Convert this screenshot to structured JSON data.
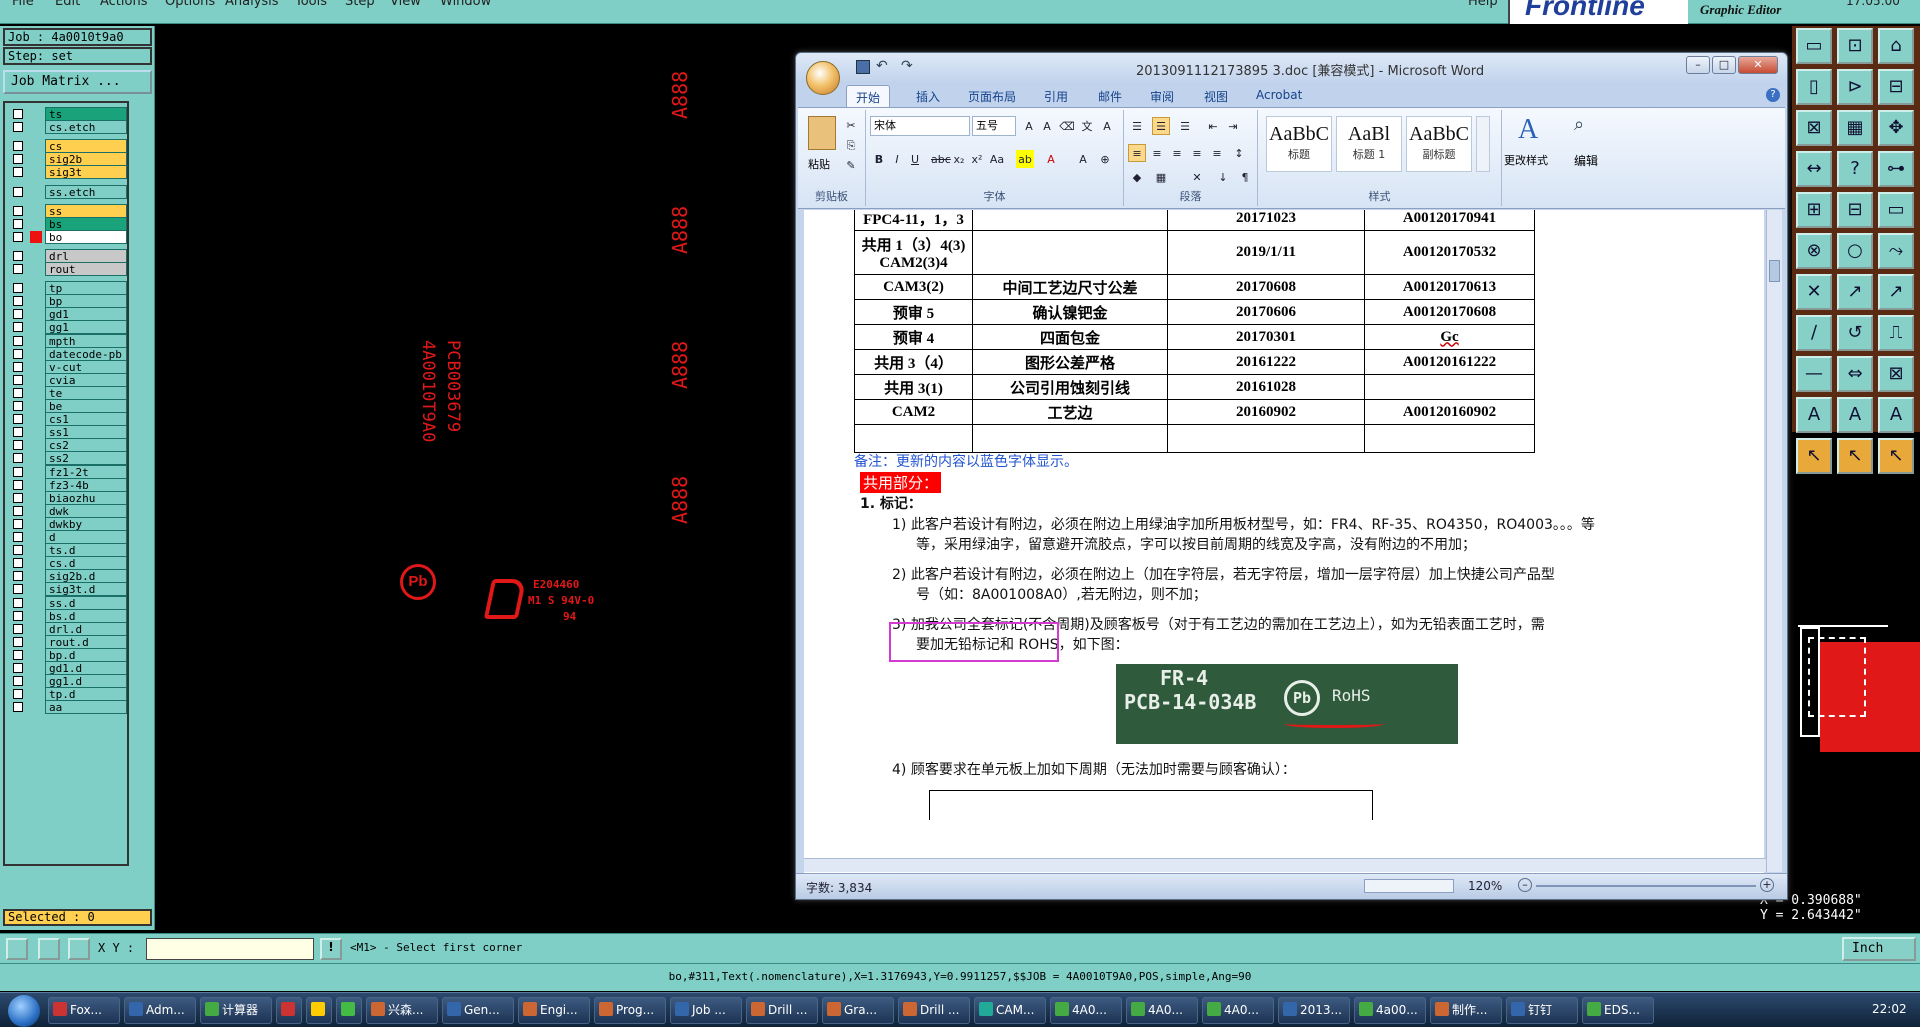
{
  "menubar": {
    "items": [
      "File",
      "Edit",
      "Actions",
      "Options",
      "Analysis",
      "Tools",
      "Step",
      "View",
      "Window"
    ],
    "help": "Help",
    "logo": "Frontline",
    "product": "Graphic Editor",
    "time": "17:05:00"
  },
  "job": {
    "job_label": "Job : 4a0010t9a0",
    "step_label": "Step: set",
    "matrix_button": "Job Matrix ...",
    "selected": "Selected : 0"
  },
  "layers": [
    {
      "name": "ts",
      "color": "#1aa37a"
    },
    {
      "name": "cs.etch",
      "color": "#7fcfc6"
    },
    {
      "name": "cs",
      "color": "#ffd050"
    },
    {
      "name": "sig2b",
      "color": "#ffd050"
    },
    {
      "name": "sig3t",
      "color": "#ffd050"
    },
    {
      "name": "ss.etch",
      "color": "#7fcfc6"
    },
    {
      "name": "ss",
      "color": "#ffd050"
    },
    {
      "name": "bs",
      "color": "#1aa37a"
    },
    {
      "name": "bo",
      "color": "#ffffff"
    },
    {
      "name": "drl",
      "color": "#c8c8c8"
    },
    {
      "name": "rout",
      "color": "#c8c8c8"
    },
    {
      "name": "tp",
      "color": "#7fcfc6"
    },
    {
      "name": "bp",
      "color": "#7fcfc6"
    },
    {
      "name": "gd1",
      "color": "#7fcfc6"
    },
    {
      "name": "gg1",
      "color": "#7fcfc6"
    },
    {
      "name": "mpth",
      "color": "#7fcfc6"
    },
    {
      "name": "datecode-pb",
      "color": "#7fcfc6"
    },
    {
      "name": "v-cut",
      "color": "#7fcfc6"
    },
    {
      "name": "cvia",
      "color": "#7fcfc6"
    },
    {
      "name": "te",
      "color": "#7fcfc6"
    },
    {
      "name": "be",
      "color": "#7fcfc6"
    },
    {
      "name": "cs1",
      "color": "#7fcfc6"
    },
    {
      "name": "ss1",
      "color": "#7fcfc6"
    },
    {
      "name": "cs2",
      "color": "#7fcfc6"
    },
    {
      "name": "ss2",
      "color": "#7fcfc6"
    },
    {
      "name": "fz1-2t",
      "color": "#7fcfc6"
    },
    {
      "name": "fz3-4b",
      "color": "#7fcfc6"
    },
    {
      "name": "biaozhu",
      "color": "#7fcfc6"
    },
    {
      "name": "dwk",
      "color": "#7fcfc6"
    },
    {
      "name": "dwkby",
      "color": "#7fcfc6"
    },
    {
      "name": "d",
      "color": "#7fcfc6"
    },
    {
      "name": "ts.d",
      "color": "#7fcfc6"
    },
    {
      "name": "cs.d",
      "color": "#7fcfc6"
    },
    {
      "name": "sig2b.d",
      "color": "#7fcfc6"
    },
    {
      "name": "sig3t.d",
      "color": "#7fcfc6"
    },
    {
      "name": "ss.d",
      "color": "#7fcfc6"
    },
    {
      "name": "bs.d",
      "color": "#7fcfc6"
    },
    {
      "name": "drl.d",
      "color": "#7fcfc6"
    },
    {
      "name": "rout.d",
      "color": "#7fcfc6"
    },
    {
      "name": "bp.d",
      "color": "#7fcfc6"
    },
    {
      "name": "gd1.d",
      "color": "#7fcfc6"
    },
    {
      "name": "gg1.d",
      "color": "#7fcfc6"
    },
    {
      "name": "tp.d",
      "color": "#7fcfc6"
    },
    {
      "name": "aa",
      "color": "#7fcfc6"
    }
  ],
  "canvas": {
    "a888": "A888",
    "pcb_text": "PCB003679",
    "job_text": "4A0010T9A0",
    "pb_mark": "Pb",
    "ul_code": "E204460",
    "ul_sub": "M1 S 94V-0",
    "ul_mark": "94"
  },
  "coords": {
    "x": "X = 0.390688\"",
    "y": "Y = 2.643442\""
  },
  "cmdrow": {
    "xy_label": "X Y :",
    "input_value": "",
    "prompt": "<M1> - Select first corner",
    "unit": "Inch"
  },
  "inforow": {
    "text": "bo,#311,Text(.nomenclature),X=1.3176943,Y=0.9911257,$$JOB = 4A0010T9A0,POS,simple,Ang=90"
  },
  "word": {
    "title": "2013091112173895 3.doc [兼容模式] - Microsoft Word",
    "tabs": [
      "开始",
      "插入",
      "页面布局",
      "引用",
      "邮件",
      "审阅",
      "视图",
      "Acrobat"
    ],
    "font_name": "宋体",
    "font_size": "五号",
    "groups": {
      "clipboard": "剪贴板",
      "font": "字体",
      "paragraph": "段落",
      "styles": "样式"
    },
    "paste": "粘贴",
    "styles": [
      {
        "sample": "AaBbC",
        "name": "标题"
      },
      {
        "sample": "AaBl",
        "name": "标题 1"
      },
      {
        "sample": "AaBbC",
        "name": "副标题"
      }
    ],
    "change_styles": "更改样式",
    "edit": "编辑",
    "table": [
      [
        "FPC4-11，1，3",
        "",
        "20171023",
        "A00120170941"
      ],
      [
        "共用 1（3）4(3) CAM2(3)4",
        "",
        "2019/1/11",
        "A00120170532"
      ],
      [
        "CAM3(2)",
        "中间工艺边尺寸公差",
        "20170608",
        "A00120170613"
      ],
      [
        "预审 5",
        "确认镍钯金",
        "20170606",
        "A00120170608"
      ],
      [
        "预审 4",
        "四面包金",
        "20170301",
        "Gc"
      ],
      [
        "共用 3（4）",
        "图形公差严格",
        "20161222",
        "A00120161222"
      ],
      [
        "共用 3(1)",
        "公司引用蚀刻引线",
        "20161028",
        ""
      ],
      [
        "CAM2",
        "工艺边",
        "20160902",
        "A00120160902"
      ],
      [
        "",
        "",
        "",
        ""
      ]
    ],
    "note": "备注：更新的内容以蓝色字体显示。",
    "section": "共用部分：",
    "h1": "1.   标记：",
    "p1a": "1)  此客户若设计有附边，必须在附边上用绿油字加所用板材型号，如：FR4、RF-35、RO4350，RO4003。。。等",
    "p1b": "等，采用绿油字，留意避开流胶点，字可以按目前周期的线宽及字高，没有附边的不用加；",
    "p2a": "2)  此客户若设计有附边，必须在附边上（加在字符层，若无字符层，增加一层字符层）加上快捷公司产品型",
    "p2b": "号（如：8A001008A0）,若无附边，则不加；",
    "p3a": "3)  加我公司全套标记(不含周期)及顾客板号（对于有工艺边的需加在工艺边上），如为无铅表面工艺时，需",
    "p3b": "要加无铅标记和 ROHS，如下图：",
    "img_l1": "FR-4",
    "img_l2": "PCB-14-034B",
    "img_pb": "Pb",
    "img_rohs": "RoHS",
    "p4": "4)  顾客要求在单元板上加如下周期（无法加时需要与顾客确认）：",
    "wordcount": "字数: 3,834",
    "zoom": "120%"
  },
  "taskbar": {
    "items": [
      "Fox...",
      "Adm...",
      "计算器",
      "",
      "",
      "",
      "兴森...",
      "Gen...",
      "Engi...",
      "Prog...",
      "Job ...",
      "Drill ...",
      "Gra...",
      "Drill ...",
      "CAM...",
      "4A0...",
      "4A0...",
      "4A0...",
      "2013...",
      "4a00...",
      "制作...",
      "钉钉",
      "EDS..."
    ],
    "clock": "22:02"
  }
}
